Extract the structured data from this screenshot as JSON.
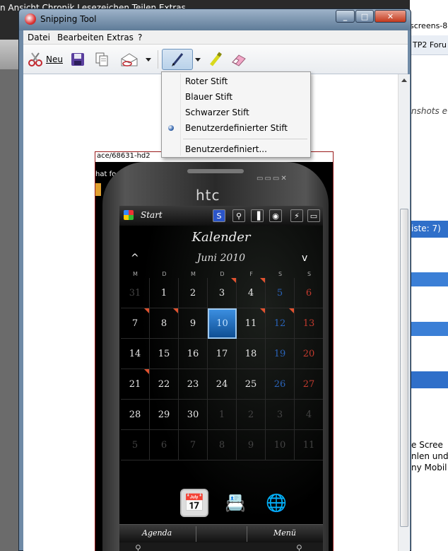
{
  "background": {
    "menu_text": "n   Ansicht   Chronik   Lesezeichen   Teilen   Extras",
    "right_title": "screens-8",
    "right_tab": "TP2 Foru",
    "right_stripe_text": "nshots e",
    "right_count": "iste: 7)",
    "right_lines": [
      "e Scree",
      "nlen und",
      "ny Mobil"
    ]
  },
  "window": {
    "title": "Snipping Tool",
    "controls": {
      "minimize": "_",
      "maximize": "□",
      "close": "✕"
    }
  },
  "menubar": {
    "items": [
      "Datei",
      "Bearbeiten",
      "Extras",
      "?"
    ]
  },
  "toolbar": {
    "new_label": "Neu",
    "icons": [
      "scissors-icon",
      "save-icon",
      "copy-icon",
      "send-icon",
      "pen-icon",
      "highlighter-icon",
      "eraser-icon"
    ]
  },
  "dropdown": {
    "items": [
      "Roter Stift",
      "Blauer Stift",
      "Schwarzer Stift",
      "Benutzerdefinierter Stift"
    ],
    "selected": "Benutzerdefinierter Stift",
    "custom": "Benutzerdefiniert..."
  },
  "capture": {
    "url": "ace/68631-hd2",
    "line2": "hat fo",
    "phone": {
      "brand": "htc",
      "status": {
        "start": "Start",
        "icons": [
          "S",
          "⚲",
          "▐",
          "◉",
          "⚡",
          "▭"
        ]
      },
      "calendar": {
        "title": "Kalender",
        "month": "Juni 2010",
        "prev": "^",
        "next": "v",
        "weekdays": [
          "M",
          "D",
          "M",
          "D",
          "F",
          "S",
          "S"
        ],
        "rows": [
          [
            "31",
            "1",
            "2",
            "3",
            "4",
            "5",
            "6"
          ],
          [
            "7",
            "8",
            "9",
            "10",
            "11",
            "12",
            "13"
          ],
          [
            "14",
            "15",
            "16",
            "17",
            "18",
            "19",
            "20"
          ],
          [
            "21",
            "22",
            "23",
            "24",
            "25",
            "26",
            "27"
          ],
          [
            "28",
            "29",
            "30",
            "1",
            "2",
            "3",
            "4"
          ],
          [
            "5",
            "6",
            "7",
            "8",
            "9",
            "10",
            "11"
          ]
        ],
        "today": "10"
      },
      "softkeys": {
        "left": "Agenda",
        "right": "Menü"
      },
      "apps": [
        "✉",
        "📅",
        "📇",
        "🌐",
        "🖼"
      ]
    }
  },
  "colors": {
    "accent": "#4170b4",
    "today": "#1f6fc0",
    "flag": "#e0522f"
  }
}
